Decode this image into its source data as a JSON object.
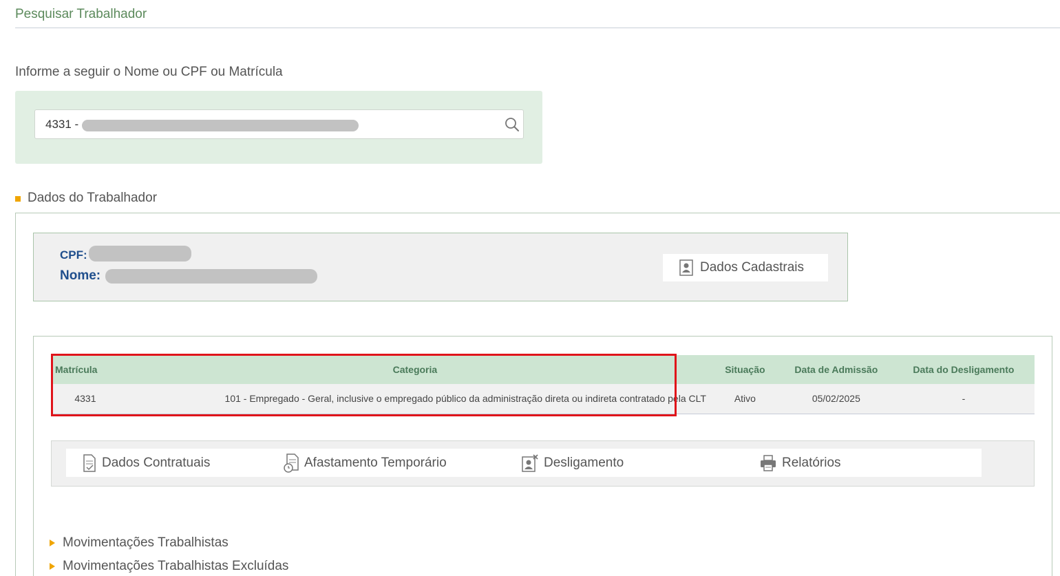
{
  "page": {
    "title": "Pesquisar Trabalhador",
    "instruction": "Informe a seguir o Nome ou CPF ou Matrícula"
  },
  "search": {
    "value": "4331 - ",
    "icon": "search-icon"
  },
  "worker_section": {
    "title": "Dados do Trabalhador",
    "cpf_label": "CPF:",
    "nome_label": "Nome:",
    "dados_cadastrais_label": "Dados Cadastrais"
  },
  "contracts_table": {
    "headers": [
      "Matrícula",
      "Categoria",
      "Situação",
      "Data de Admissão",
      "Data do Desligamento"
    ],
    "rows": [
      [
        "4331",
        "101 - Empregado - Geral, inclusive o empregado público da administração direta ou indireta contratado pela CLT",
        "Ativo",
        "05/02/2025",
        "-"
      ]
    ]
  },
  "actions": {
    "contratuais": "Dados Contratuais",
    "afastamento": "Afastamento Temporário",
    "desligamento": "Desligamento",
    "relatorios": "Relatórios"
  },
  "sections": {
    "movimentacoes": "Movimentações Trabalhistas",
    "movimentacoes_excluidas": "Movimentações Trabalhistas Excluídas"
  },
  "colors": {
    "accent_green": "#5c8a5c",
    "panel_green": "#e1efe3",
    "header_green": "#cde5d2",
    "label_blue": "#1f4e8c",
    "bullet_orange": "#f0a500",
    "highlight_red": "#e0141a"
  }
}
